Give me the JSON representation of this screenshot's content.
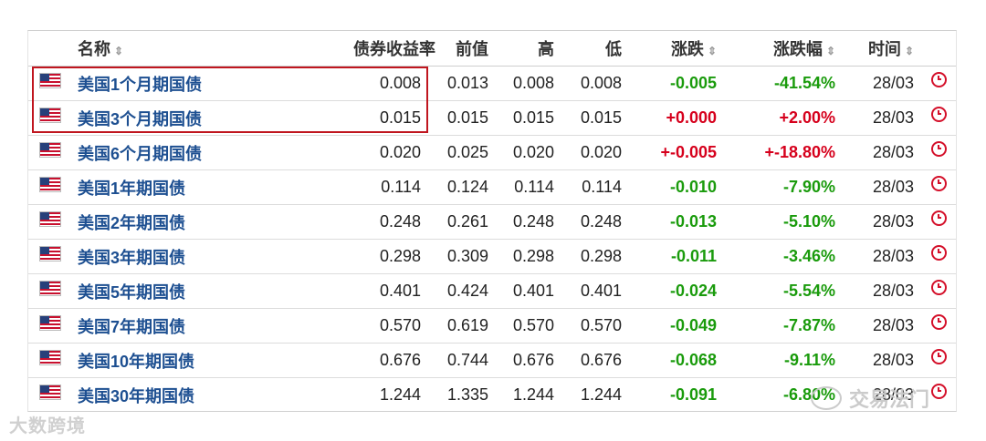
{
  "columns": {
    "name": "名称",
    "yield": "债券收益率",
    "prev": "前值",
    "high": "高",
    "low": "低",
    "change": "涨跌",
    "change_pct": "涨跌幅",
    "time": "时间"
  },
  "sort_glyph": "⇕",
  "rows": [
    {
      "name": "美国1个月期国债",
      "yield": "0.008",
      "prev": "0.013",
      "high": "0.008",
      "low": "0.008",
      "change": "-0.005",
      "change_pct": "-41.54%",
      "time": "28/03",
      "dir": "neg"
    },
    {
      "name": "美国3个月期国债",
      "yield": "0.015",
      "prev": "0.015",
      "high": "0.015",
      "low": "0.015",
      "change": "+0.000",
      "change_pct": "+2.00%",
      "time": "28/03",
      "dir": "pos"
    },
    {
      "name": "美国6个月期国债",
      "yield": "0.020",
      "prev": "0.025",
      "high": "0.020",
      "low": "0.020",
      "change": "+-0.005",
      "change_pct": "+-18.80%",
      "time": "28/03",
      "dir": "pos"
    },
    {
      "name": "美国1年期国债",
      "yield": "0.114",
      "prev": "0.124",
      "high": "0.114",
      "low": "0.114",
      "change": "-0.010",
      "change_pct": "-7.90%",
      "time": "28/03",
      "dir": "neg"
    },
    {
      "name": "美国2年期国债",
      "yield": "0.248",
      "prev": "0.261",
      "high": "0.248",
      "low": "0.248",
      "change": "-0.013",
      "change_pct": "-5.10%",
      "time": "28/03",
      "dir": "neg"
    },
    {
      "name": "美国3年期国债",
      "yield": "0.298",
      "prev": "0.309",
      "high": "0.298",
      "low": "0.298",
      "change": "-0.011",
      "change_pct": "-3.46%",
      "time": "28/03",
      "dir": "neg"
    },
    {
      "name": "美国5年期国债",
      "yield": "0.401",
      "prev": "0.424",
      "high": "0.401",
      "low": "0.401",
      "change": "-0.024",
      "change_pct": "-5.54%",
      "time": "28/03",
      "dir": "neg"
    },
    {
      "name": "美国7年期国债",
      "yield": "0.570",
      "prev": "0.619",
      "high": "0.570",
      "low": "0.570",
      "change": "-0.049",
      "change_pct": "-7.87%",
      "time": "28/03",
      "dir": "neg"
    },
    {
      "name": "美国10年期国债",
      "yield": "0.676",
      "prev": "0.744",
      "high": "0.676",
      "low": "0.676",
      "change": "-0.068",
      "change_pct": "-9.11%",
      "time": "28/03",
      "dir": "neg"
    },
    {
      "name": "美国30年期国债",
      "yield": "1.244",
      "prev": "1.335",
      "high": "1.244",
      "low": "1.244",
      "change": "-0.091",
      "change_pct": "-6.80%",
      "time": "28/03",
      "dir": "neg"
    }
  ],
  "row_icons": {
    "flag": "us-flag-icon",
    "clock": "clock-icon"
  },
  "colors": {
    "positive": "#d6001c",
    "negative": "#1a9b0c",
    "link": "#1d4f91",
    "highlight_box": "#c0161f"
  },
  "watermarks": {
    "left": "大数跨境",
    "right": "交易法门"
  }
}
